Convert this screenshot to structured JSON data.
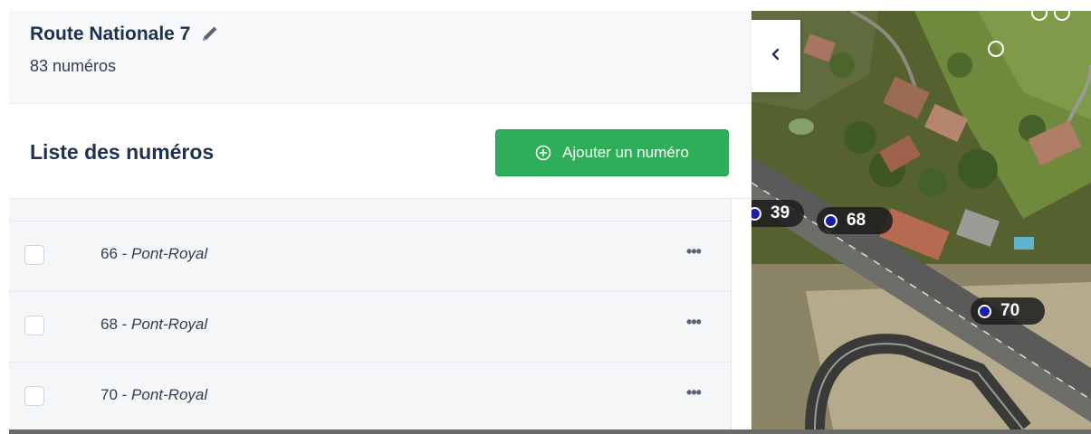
{
  "street": {
    "name": "Route Nationale 7",
    "count": "83 numéros",
    "edit_icon": "pencil-icon"
  },
  "list": {
    "title": "Liste des numéros",
    "add_button_label": "Ajouter un numéro",
    "add_button_icon": "plus-circle-icon",
    "rows": [
      {
        "number": "66",
        "separator": " - ",
        "place": "Pont-Royal",
        "menu": "•••"
      },
      {
        "number": "68",
        "separator": " - ",
        "place": "Pont-Royal",
        "menu": "•••"
      },
      {
        "number": "70",
        "separator": " - ",
        "place": "Pont-Royal",
        "menu": "•••"
      }
    ]
  },
  "map": {
    "collapse_icon": "chevron-left-icon",
    "markers": [
      {
        "label": "39"
      },
      {
        "label": "68"
      },
      {
        "label": "70"
      }
    ]
  },
  "colors": {
    "accent_green": "#2fae5a",
    "title_navy": "#1e3250",
    "marker_blue": "#1b1fa8"
  }
}
